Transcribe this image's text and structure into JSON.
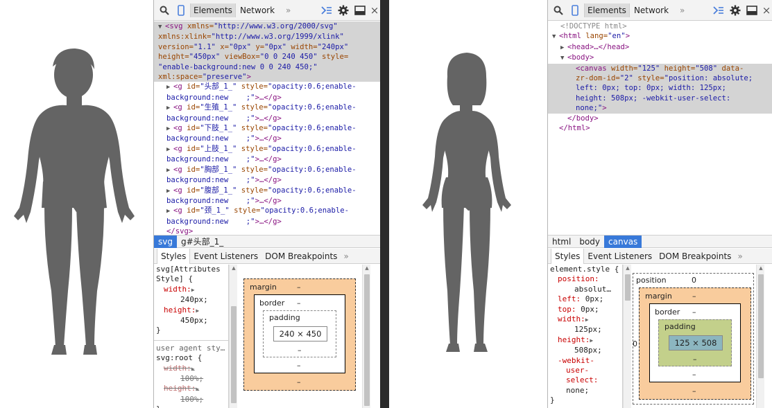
{
  "left": {
    "toolbar": {
      "tab_elements": "Elements",
      "tab_network": "Network",
      "more": "»",
      "close": "×"
    },
    "dom": {
      "svg_open": [
        "<svg",
        " xmlns=",
        "\"http://www.w3.org/2000/svg\"",
        "xmlns:xlink=",
        "\"http://www.w3.org/1999/xlink\"",
        "version=",
        "\"1.1\"",
        " x=",
        "\"0px\"",
        " y=",
        "\"0px\"",
        " width=",
        "\"240px\"",
        "height=",
        "\"450px\"",
        " viewBox=",
        "\"0 0 240 450\"",
        " style=",
        "\"enable-background:new 0 0 240 450;\"",
        "xml:space=",
        "\"preserve\"",
        ">"
      ],
      "groups": [
        {
          "id": "\"头部_1_\""
        },
        {
          "id": "\"生殖_1_\""
        },
        {
          "id": "\"下肢_1_\""
        },
        {
          "id": "\"上肢_1_\""
        },
        {
          "id": "\"胸部_1_\""
        },
        {
          "id": "\"腹部_1_\""
        },
        {
          "id": "\"颈_1_\""
        }
      ],
      "g_tag": "<g",
      "id_attr": " id=",
      "style_attr": "style=",
      "style_val_1": "\"opacity:0.6;enable-",
      "style_val_2": "background:new    ;\"",
      "collapsed": ">…</g>",
      "svg_close": "</svg>"
    },
    "crumbs": [
      "svg",
      "g#头部_1_"
    ],
    "subtabs": [
      "Styles",
      "Event Listeners",
      "DOM Breakpoints"
    ],
    "subtabs_more": "»",
    "styles": {
      "rule1_selector": "svg[Attributes",
      "rule1_selector2": "Style] {",
      "width_name": "width:",
      "width_val": "240px;",
      "height_name": "height:",
      "height_val": "450px;",
      "close": "}",
      "ua_label": "user agent sty…",
      "rule2_selector": "svg:root {",
      "ua_width_name": "width:",
      "ua_width_val": "100%;",
      "ua_height_name": "height:",
      "ua_height_val": "100%;",
      "close2": "}"
    },
    "boxmodel": {
      "margin": "margin",
      "border": "border",
      "padding": "padding",
      "content": "240 × 450",
      "dash": "–"
    }
  },
  "right": {
    "toolbar": {
      "tab_elements": "Elements",
      "tab_network": "Network",
      "more": "»",
      "close": "×"
    },
    "dom": {
      "doctype": "<!DOCTYPE html>",
      "html_open": "<html",
      "lang_attr": " lang=",
      "lang_val": "\"en\"",
      "head": "<head>…</head>",
      "body_open": "<body>",
      "canvas_l1": [
        "<canvas",
        " width=",
        "\"125\"",
        " height=",
        "\"508\"",
        " data-"
      ],
      "canvas_l2": [
        "zr-dom-id=",
        "\"2\"",
        " style=",
        "\"position: absolute;"
      ],
      "canvas_l3": "left: 0px; top: 0px; width: 125px;",
      "canvas_l4": "height: 508px; -webkit-user-select:",
      "canvas_l5": [
        "none;\"",
        ">"
      ],
      "body_close": "</body>",
      "html_close": "</html>",
      "gt": ">"
    },
    "crumbs": [
      "html",
      "body",
      "canvas"
    ],
    "subtabs": [
      "Styles",
      "Event Listeners",
      "DOM Breakpoints"
    ],
    "subtabs_more": "»",
    "styles": {
      "selector": "element.style {",
      "position_name": "position:",
      "position_val": "absolut…",
      "left_name": "left:",
      "left_val": "0px;",
      "top_name": "top:",
      "top_val": "0px;",
      "width_name": "width:",
      "width_val": "125px;",
      "height_name": "height:",
      "height_val": "508px;",
      "user_select_1": "-webkit-",
      "user_select_2": "user-",
      "user_select_3": "select:",
      "user_select_val": "none;",
      "close": "}"
    },
    "boxmodel": {
      "position": "position",
      "position_val": "0",
      "margin": "margin",
      "border": "border",
      "padding": "padding",
      "content": "125 × 508",
      "dash": "–",
      "zero": "0"
    }
  },
  "colors": {
    "figure": "#646464",
    "selected_row": "#d4d4d4",
    "crumb_active": "#3879d9",
    "margin_box": "#f9cc9d",
    "padding_green": "#c3d08b",
    "content_blue": "#8cb6c0"
  },
  "icons": [
    "search-icon",
    "device-icon",
    "console-icon",
    "gear-icon",
    "dock-icon",
    "close-icon"
  ]
}
